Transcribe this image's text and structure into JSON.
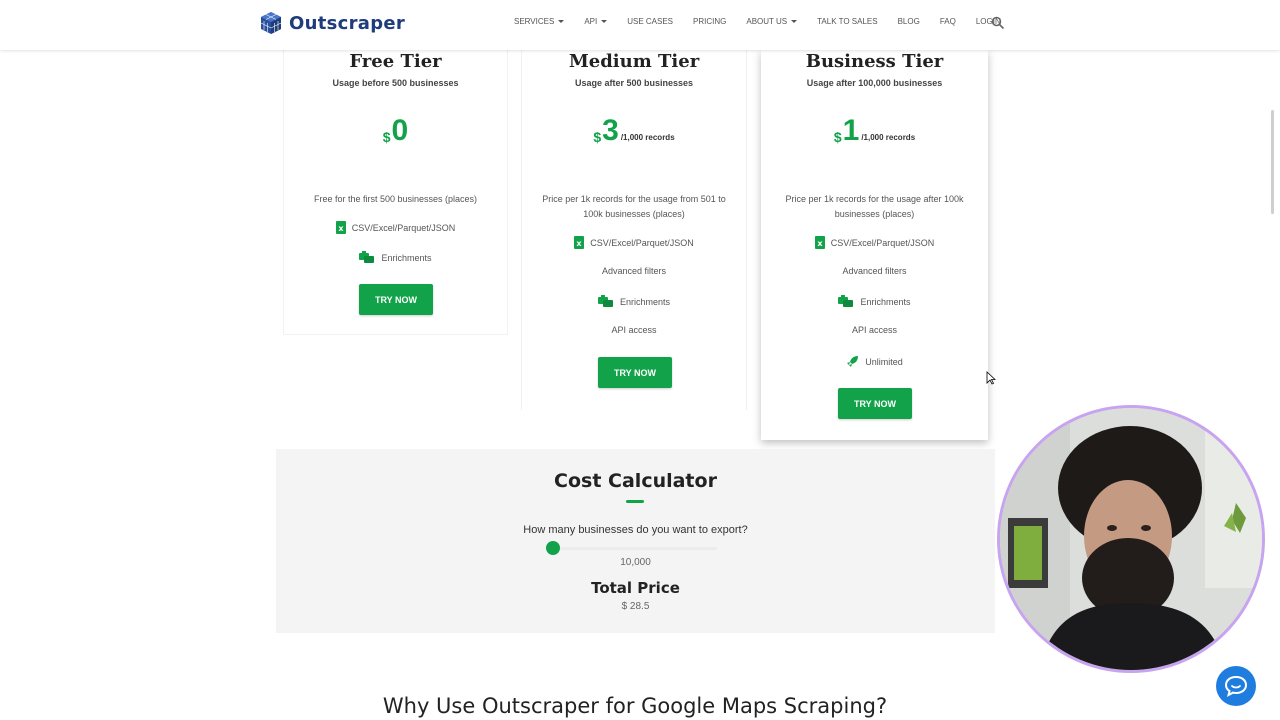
{
  "header": {
    "logo_text": "Outscraper",
    "nav": [
      {
        "label": "SERVICES",
        "caret": true
      },
      {
        "label": "API",
        "caret": true
      },
      {
        "label": "USE CASES",
        "caret": false
      },
      {
        "label": "PRICING",
        "caret": false
      },
      {
        "label": "ABOUT US",
        "caret": true
      },
      {
        "label": "TALK TO SALES",
        "caret": false
      },
      {
        "label": "BLOG",
        "caret": false
      },
      {
        "label": "FAQ",
        "caret": false
      },
      {
        "label": "LOGIN",
        "caret": false
      }
    ]
  },
  "tiers": {
    "free": {
      "title": "Free Tier",
      "subtitle": "Usage before 500 businesses",
      "currency": "$",
      "price": "0",
      "description": "Free for the first 500 businesses (places)",
      "features": [
        "CSV/Excel/Parquet/JSON",
        "Enrichments"
      ],
      "button": "TRY NOW"
    },
    "medium": {
      "title": "Medium Tier",
      "subtitle": "Usage after 500 businesses",
      "currency": "$",
      "price": "3",
      "unit": "/1,000 records",
      "description": "Price per 1k records for the usage from 501 to 100k businesses (places)",
      "features": [
        "CSV/Excel/Parquet/JSON",
        "Advanced filters",
        "Enrichments",
        "API access"
      ],
      "button": "TRY NOW"
    },
    "business": {
      "title": "Business Tier",
      "subtitle": "Usage after 100,000 businesses",
      "currency": "$",
      "price": "1",
      "unit": "/1,000 records",
      "description": "Price per 1k records for the usage after 100k businesses (places)",
      "features": [
        "CSV/Excel/Parquet/JSON",
        "Advanced filters",
        "Enrichments",
        "API access",
        "Unlimited"
      ],
      "button": "TRY NOW"
    }
  },
  "calculator": {
    "title": "Cost Calculator",
    "question": "How many businesses do you want to export?",
    "value": "10,000",
    "slider_fraction": 0.0,
    "total_label": "Total Price",
    "total": "$ 28.5"
  },
  "why_heading": "Why Use Outscraper for Google Maps Scraping?",
  "colors": {
    "accent": "#12a34a",
    "brand": "#1f3d7a",
    "chat": "#1f7de0",
    "webcam_ring": "#c8a4f0"
  }
}
